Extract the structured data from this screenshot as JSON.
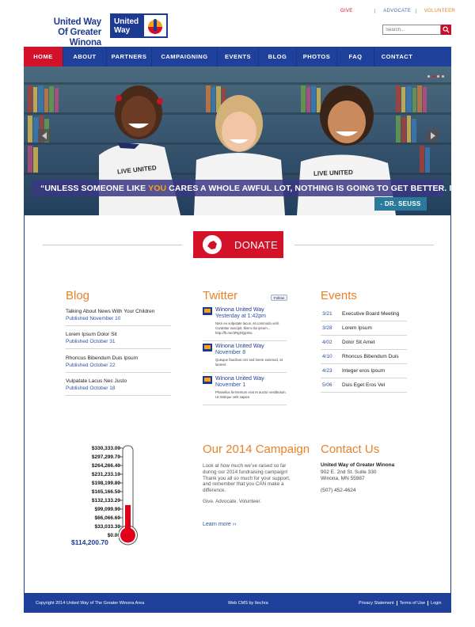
{
  "header": {
    "logo_line1": "United Way",
    "logo_line2": "Of Greater Winona",
    "badge_line1": "United",
    "badge_line2": "Way",
    "top_links": [
      "GIVE",
      "ADVOCATE",
      "VOLUNTEER"
    ],
    "search_placeholder": "Search..."
  },
  "nav": {
    "items": [
      "HOME",
      "ABOUT",
      "PARTNERS",
      "CAMPAIGNING",
      "EVENTS",
      "BLOG",
      "PHOTOS",
      "FAQ",
      "CONTACT"
    ],
    "active": "HOME"
  },
  "hero": {
    "quote_before": "“UNLESS SOMEONE LIKE ",
    "quote_highlight": "YOU",
    "quote_after": " CARES A WHOLE AWFUL LOT, NOTHING IS GOING TO GET BETTER. IT’S NOT.”",
    "attribution": "- DR. SEUSS",
    "shirt_text": "LIVE UNITED",
    "slide_count": 4,
    "active_slide": 2
  },
  "donate": {
    "label": "DONATE"
  },
  "blog": {
    "title": "Blog",
    "posts": [
      {
        "title": "Talking About News With Your Children",
        "date": "Published November 10"
      },
      {
        "title": "Lorem Ipsum Dolor Sit",
        "date": "Published October 31"
      },
      {
        "title": "Rhoncus Bibendum Duis Ipsum",
        "date": "Published October 22"
      },
      {
        "title": "Vulpatate Lacus Nec Justo",
        "date": "Published October 18"
      }
    ]
  },
  "twitter": {
    "title": "Twitter",
    "follow_label": "Follow",
    "tweets": [
      {
        "name": "Winona United Way",
        "time": "Yesterday at 1:42pm",
        "text": "Nam eu vulputate lacus, at commodo velit. Curabitur suscipit, libero dui ipsum... http://fb.me/3RgDQpX5c"
      },
      {
        "name": "Winona United Way",
        "time": "November 8",
        "text": "Quisque faucibus orci sed lorem euismod, at laoreet."
      },
      {
        "name": "Winona United Way",
        "time": "November 1",
        "text": "Phasellus fermentum erat et auctor vestibulum. Ut tristique velit sapien."
      }
    ]
  },
  "events": {
    "title": "Events",
    "items": [
      {
        "date": "3/21",
        "name": "Executive Board Meeting"
      },
      {
        "date": "3/28",
        "name": "Lorem Ipsum"
      },
      {
        "date": "4/02",
        "name": "Dolor Sit Amet"
      },
      {
        "date": "4/10",
        "name": "Rhoncus Bibendum Duis"
      },
      {
        "date": "4/23",
        "name": "Integer eros Ipsum"
      },
      {
        "date": "5/06",
        "name": "Duis Eget Eros Vel"
      }
    ]
  },
  "thermometer": {
    "scale_labels": [
      "$330,333.00",
      "$297,299.70",
      "$264,266.40",
      "$231,233.10",
      "$198,199.80",
      "$165,166.50",
      "$132,133.20",
      "$99,099.90",
      "$66,066.60",
      "$33,033.30",
      "$0.00"
    ],
    "max": 330333.0,
    "raised": 114200.7,
    "raised_label": "$114,200.70",
    "fill_color": "#e0001b"
  },
  "campaign": {
    "title": "Our 2014 Campaign",
    "text": "Look at how much we’ve raised so far during our 2014 fundraising campaign! Thank you all so much for your support, and remember that you CAN make a difference.",
    "tagline": "Give. Advocate. Volunteer.",
    "learn_more": "Learn more ››"
  },
  "contact": {
    "title": "Contact Us",
    "org": "United Way of Greater Winona",
    "address1": "902 E. 2nd St. Suite 330",
    "address2": "Winona, MN 55987",
    "phone": "(507) 452-4624"
  },
  "footer": {
    "copyright": "Copyright 2014 United Way of The Greater Winona Area",
    "cms": "Web CMS by Itechra",
    "links": [
      "Privacy Statement",
      "Terms of Use",
      "Login"
    ]
  },
  "colors": {
    "brand_blue": "#1f419c",
    "brand_red": "#d3122a",
    "accent_orange": "#e8822a",
    "link_blue": "#2b52a4"
  }
}
